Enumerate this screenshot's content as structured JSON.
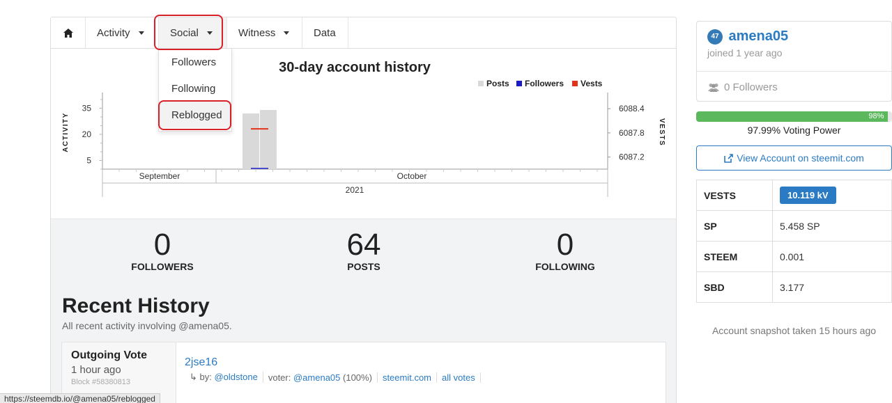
{
  "nav": {
    "home_icon": "home-icon",
    "tabs": [
      {
        "label": "Activity"
      },
      {
        "label": "Social"
      },
      {
        "label": "Witness"
      },
      {
        "label": "Data"
      }
    ],
    "social_dropdown": [
      "Followers",
      "Following",
      "Reblogged"
    ]
  },
  "chart_data": {
    "type": "bar",
    "title": "30-day account history",
    "ylabel": "ACTIVITY",
    "y2label": "VESTS",
    "legend": [
      "Posts",
      "Followers",
      "Vests"
    ],
    "legend_colors": [
      "#d9d9d9",
      "#1a1ac9",
      "#e2331a"
    ],
    "y_ticks": [
      "35",
      "20",
      "5"
    ],
    "y2_ticks": [
      "6088.4",
      "6087.8",
      "6087.2"
    ],
    "x_month_labels": [
      "September",
      "October"
    ],
    "x_year_label": "2021",
    "legend_position": "top-right",
    "series": [
      {
        "name": "Posts",
        "values": [
          32,
          34
        ]
      },
      {
        "name": "Followers",
        "values": [
          0,
          0
        ]
      },
      {
        "name": "Vests",
        "values": [
          6087.9
        ]
      }
    ]
  },
  "stats": [
    {
      "value": "0",
      "label": "FOLLOWERS"
    },
    {
      "value": "64",
      "label": "POSTS"
    },
    {
      "value": "0",
      "label": "FOLLOWING"
    }
  ],
  "recent": {
    "title": "Recent History",
    "subtitle": "All recent activity involving @amena05.",
    "item": {
      "type": "Outgoing Vote",
      "time": "1 hour ago",
      "block": "Block #58380813",
      "link": "2jse16",
      "by_prefix": "↳ by:",
      "author": "@oldstone",
      "voter_prefix": "voter:",
      "voter": "@amena05",
      "weight": "(100%)",
      "site": "steemit.com",
      "all_votes": "all votes"
    }
  },
  "profile": {
    "reputation": "47",
    "username": "amena05",
    "joined": "joined 1 year ago",
    "followers": "0 Followers",
    "voting_power_pct": 98,
    "voting_power_badge": "98%",
    "voting_power_text": "97.99% Voting Power",
    "view_button": "View Account on steemit.com"
  },
  "balances": [
    {
      "key": "VESTS",
      "value": "10.119 kV"
    },
    {
      "key": "SP",
      "value": "5.458 SP"
    },
    {
      "key": "STEEM",
      "value": "0.001"
    },
    {
      "key": "SBD",
      "value": "3.177"
    }
  ],
  "snapshot": "Account snapshot taken 15 hours ago",
  "status_url": "https://steemdb.io/@amena05/reblogged"
}
